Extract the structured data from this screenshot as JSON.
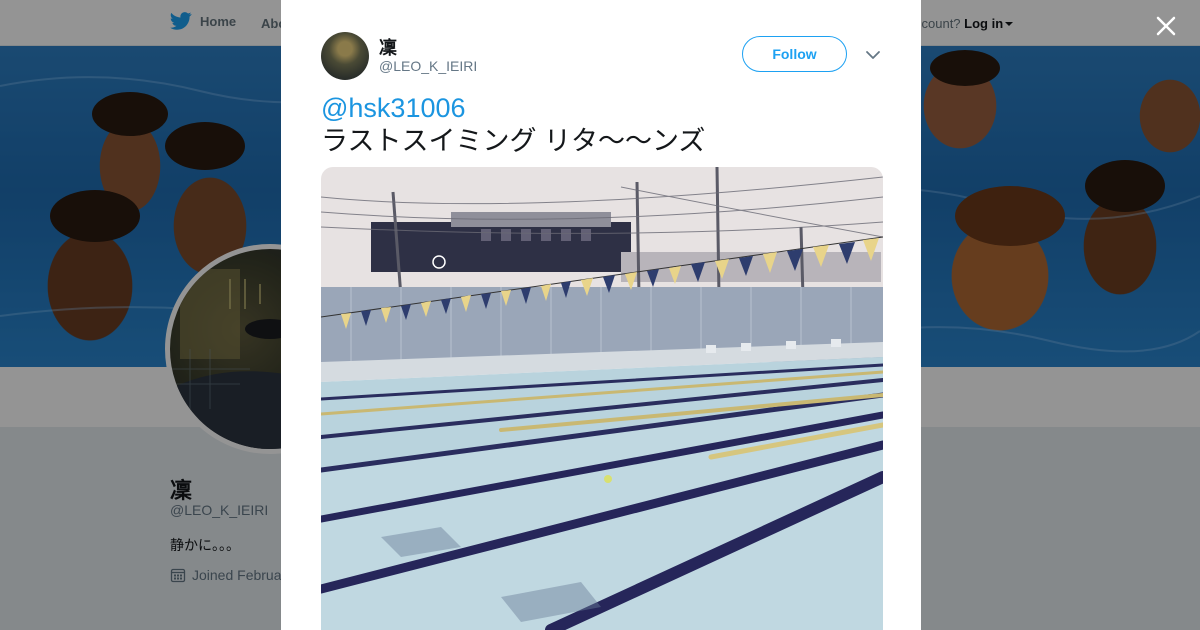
{
  "nav": {
    "home_label": "Home",
    "about_label": "Abo",
    "account_prompt": "ccount?",
    "login_label": "Log in"
  },
  "profile": {
    "name": "凜",
    "handle": "@LEO_K_IEIRI",
    "bio": "静かに。。。",
    "joined": "Joined Februa"
  },
  "tweet": {
    "author_name": "凜",
    "author_handle": "@LEO_K_IEIRI",
    "follow_label": "Follow",
    "mention": "@hsk31006",
    "text": "ラストスイミング リタ〜〜ンズ"
  },
  "colors": {
    "twitter_blue": "#1da1f2",
    "link_blue": "#1b95e0",
    "pool_water": "#b9d3dd",
    "lane_rope": "#26265a"
  },
  "icons": {
    "logo": "twitter-bird-icon",
    "close": "close-icon",
    "calendar": "calendar-icon",
    "more": "chevron-down-icon"
  }
}
